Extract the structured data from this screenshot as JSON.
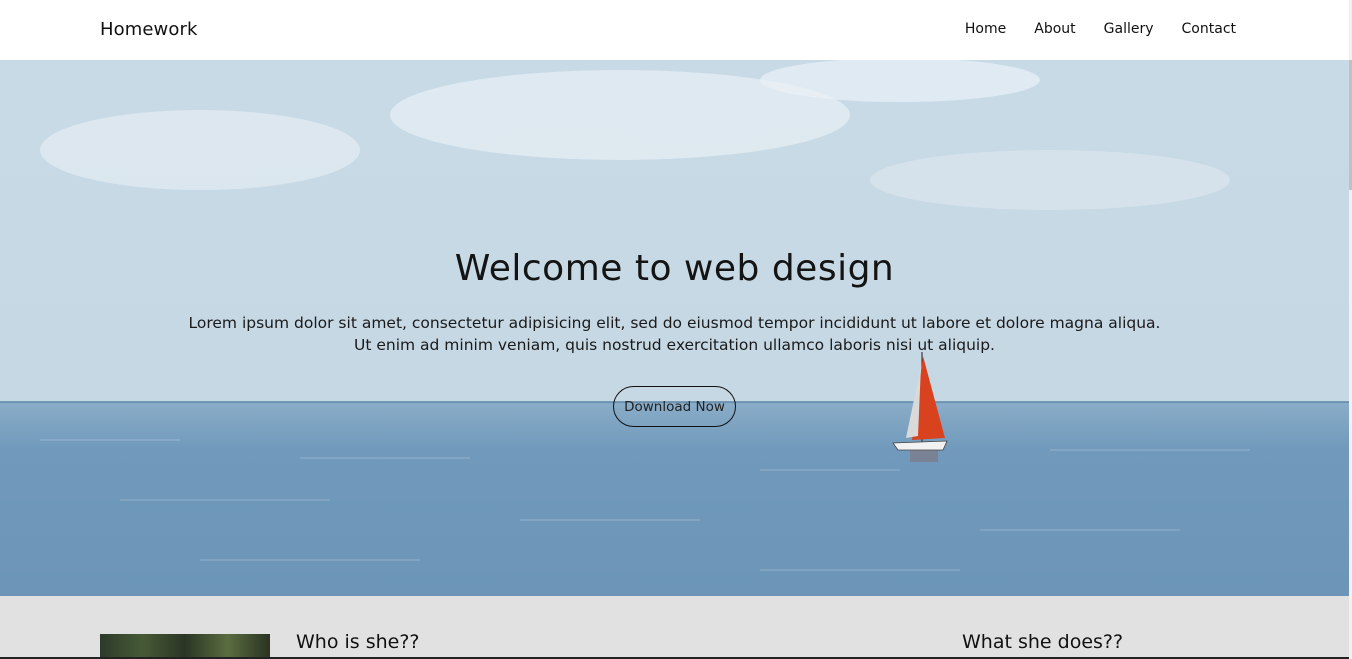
{
  "header": {
    "brand": "Homework",
    "nav": [
      {
        "label": "Home"
      },
      {
        "label": "About"
      },
      {
        "label": "Gallery"
      },
      {
        "label": "Contact"
      }
    ]
  },
  "hero": {
    "title": "Welcome to web design",
    "text_line1": "Lorem ipsum dolor sit amet, consectetur adipisicing elit, sed do eiusmod tempor incididunt ut labore et dolore magna aliqua.",
    "text_line2": "Ut enim ad minim veniam, quis nostrud exercitation ullamco laboris nisi ut aliquip.",
    "button_label": "Download Now",
    "sail_color": "#d8421f"
  },
  "lower": {
    "heading_left": "Who is she??",
    "heading_right": "What she does??"
  }
}
